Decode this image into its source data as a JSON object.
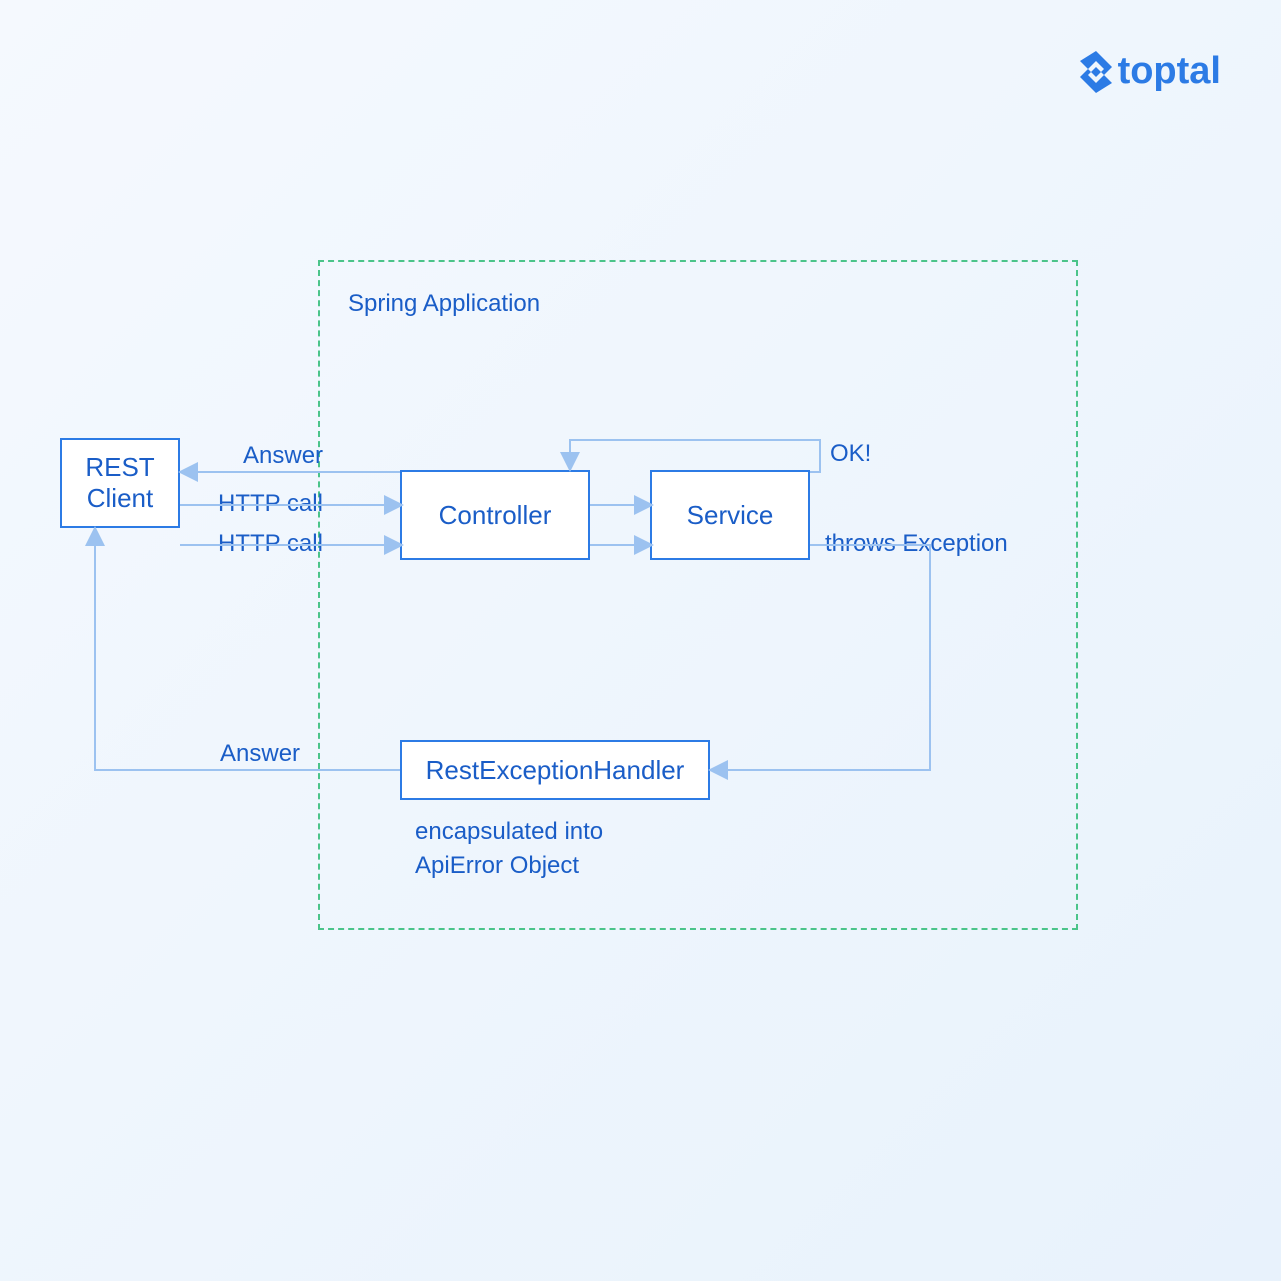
{
  "logo": {
    "text": "toptal"
  },
  "container": {
    "label": "Spring Application"
  },
  "nodes": {
    "rest_client": "REST\nClient",
    "controller": "Controller",
    "service": "Service",
    "handler": "RestExceptionHandler"
  },
  "edge_labels": {
    "answer_top": "Answer",
    "http_call_1": "HTTP call",
    "http_call_2": "HTTP call",
    "ok": "OK!",
    "throws": "throws Exception",
    "answer_bottom": "Answer",
    "encapsulated": "encapsulated into\nApiError Object"
  }
}
